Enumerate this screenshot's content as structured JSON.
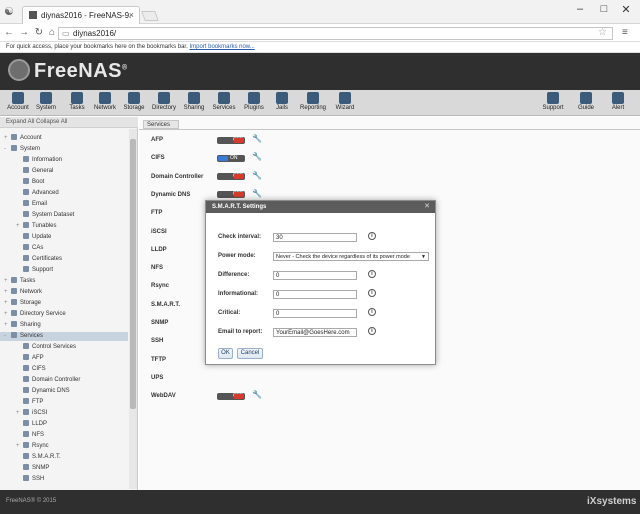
{
  "browser": {
    "tab_title": "diynas2016 - FreeNAS-9.",
    "url": "diynas2016/",
    "bookmarks_text": "For quick access, place your bookmarks here on the bookmarks bar.",
    "bookmarks_link": "Import bookmarks now..."
  },
  "app": {
    "logo": "FreeNAS",
    "footer": "FreeNAS® © 2015",
    "footer_brand": "iXsystems"
  },
  "toolbar": {
    "left": [
      "Account",
      "System",
      "Tasks",
      "Network",
      "Storage",
      "Directory",
      "Sharing",
      "Services",
      "Plugins",
      "Jails",
      "Reporting",
      "Wizard"
    ],
    "right": [
      "Support",
      "Guide",
      "Alert"
    ]
  },
  "tree": {
    "header": "Expand All   Collapse All",
    "items": [
      {
        "label": "Account",
        "indent": 0,
        "exp": "+"
      },
      {
        "label": "System",
        "indent": 0,
        "exp": "-"
      },
      {
        "label": "Information",
        "indent": 1,
        "exp": ""
      },
      {
        "label": "General",
        "indent": 1,
        "exp": ""
      },
      {
        "label": "Boot",
        "indent": 1,
        "exp": ""
      },
      {
        "label": "Advanced",
        "indent": 1,
        "exp": ""
      },
      {
        "label": "Email",
        "indent": 1,
        "exp": ""
      },
      {
        "label": "System Dataset",
        "indent": 1,
        "exp": ""
      },
      {
        "label": "Tunables",
        "indent": 1,
        "exp": "+"
      },
      {
        "label": "Update",
        "indent": 1,
        "exp": ""
      },
      {
        "label": "CAs",
        "indent": 1,
        "exp": ""
      },
      {
        "label": "Certificates",
        "indent": 1,
        "exp": ""
      },
      {
        "label": "Support",
        "indent": 1,
        "exp": ""
      },
      {
        "label": "Tasks",
        "indent": 0,
        "exp": "+"
      },
      {
        "label": "Network",
        "indent": 0,
        "exp": "+"
      },
      {
        "label": "Storage",
        "indent": 0,
        "exp": "+"
      },
      {
        "label": "Directory Service",
        "indent": 0,
        "exp": "+"
      },
      {
        "label": "Sharing",
        "indent": 0,
        "exp": "+"
      },
      {
        "label": "Services",
        "indent": 0,
        "exp": "-",
        "selected": true
      },
      {
        "label": "Control Services",
        "indent": 1,
        "exp": ""
      },
      {
        "label": "AFP",
        "indent": 1,
        "exp": ""
      },
      {
        "label": "CIFS",
        "indent": 1,
        "exp": ""
      },
      {
        "label": "Domain Controller",
        "indent": 1,
        "exp": ""
      },
      {
        "label": "Dynamic DNS",
        "indent": 1,
        "exp": ""
      },
      {
        "label": "FTP",
        "indent": 1,
        "exp": ""
      },
      {
        "label": "iSCSI",
        "indent": 1,
        "exp": "+"
      },
      {
        "label": "LLDP",
        "indent": 1,
        "exp": ""
      },
      {
        "label": "NFS",
        "indent": 1,
        "exp": ""
      },
      {
        "label": "Rsync",
        "indent": 1,
        "exp": "+"
      },
      {
        "label": "S.M.A.R.T.",
        "indent": 1,
        "exp": ""
      },
      {
        "label": "SNMP",
        "indent": 1,
        "exp": ""
      },
      {
        "label": "SSH",
        "indent": 1,
        "exp": ""
      }
    ]
  },
  "content": {
    "tab": "Services",
    "services": [
      {
        "name": "AFP",
        "state": "OFF"
      },
      {
        "name": "CIFS",
        "state": "ON"
      },
      {
        "name": "Domain Controller",
        "state": "OFF"
      },
      {
        "name": "Dynamic DNS",
        "state": "OFF"
      },
      {
        "name": "FTP",
        "state": ""
      },
      {
        "name": "iSCSI",
        "state": ""
      },
      {
        "name": "LLDP",
        "state": ""
      },
      {
        "name": "NFS",
        "state": ""
      },
      {
        "name": "Rsync",
        "state": ""
      },
      {
        "name": "S.M.A.R.T.",
        "state": ""
      },
      {
        "name": "SNMP",
        "state": ""
      },
      {
        "name": "SSH",
        "state": ""
      },
      {
        "name": "TFTP",
        "state": ""
      },
      {
        "name": "UPS",
        "state": ""
      },
      {
        "name": "WebDAV",
        "state": "OFF"
      }
    ]
  },
  "dialog": {
    "title": "S.M.A.R.T. Settings",
    "fields": {
      "check_interval": {
        "label": "Check interval:",
        "value": "30"
      },
      "power_mode": {
        "label": "Power mode:",
        "value": "Never - Check the device regardless of its power mode"
      },
      "difference": {
        "label": "Difference:",
        "value": "0"
      },
      "informational": {
        "label": "Informational:",
        "value": "0"
      },
      "critical": {
        "label": "Critical:",
        "value": "0"
      },
      "email": {
        "label": "Email to report:",
        "value": "YourEmail@GoesHere.com"
      }
    },
    "ok_label": "OK",
    "cancel_label": "Cancel"
  }
}
